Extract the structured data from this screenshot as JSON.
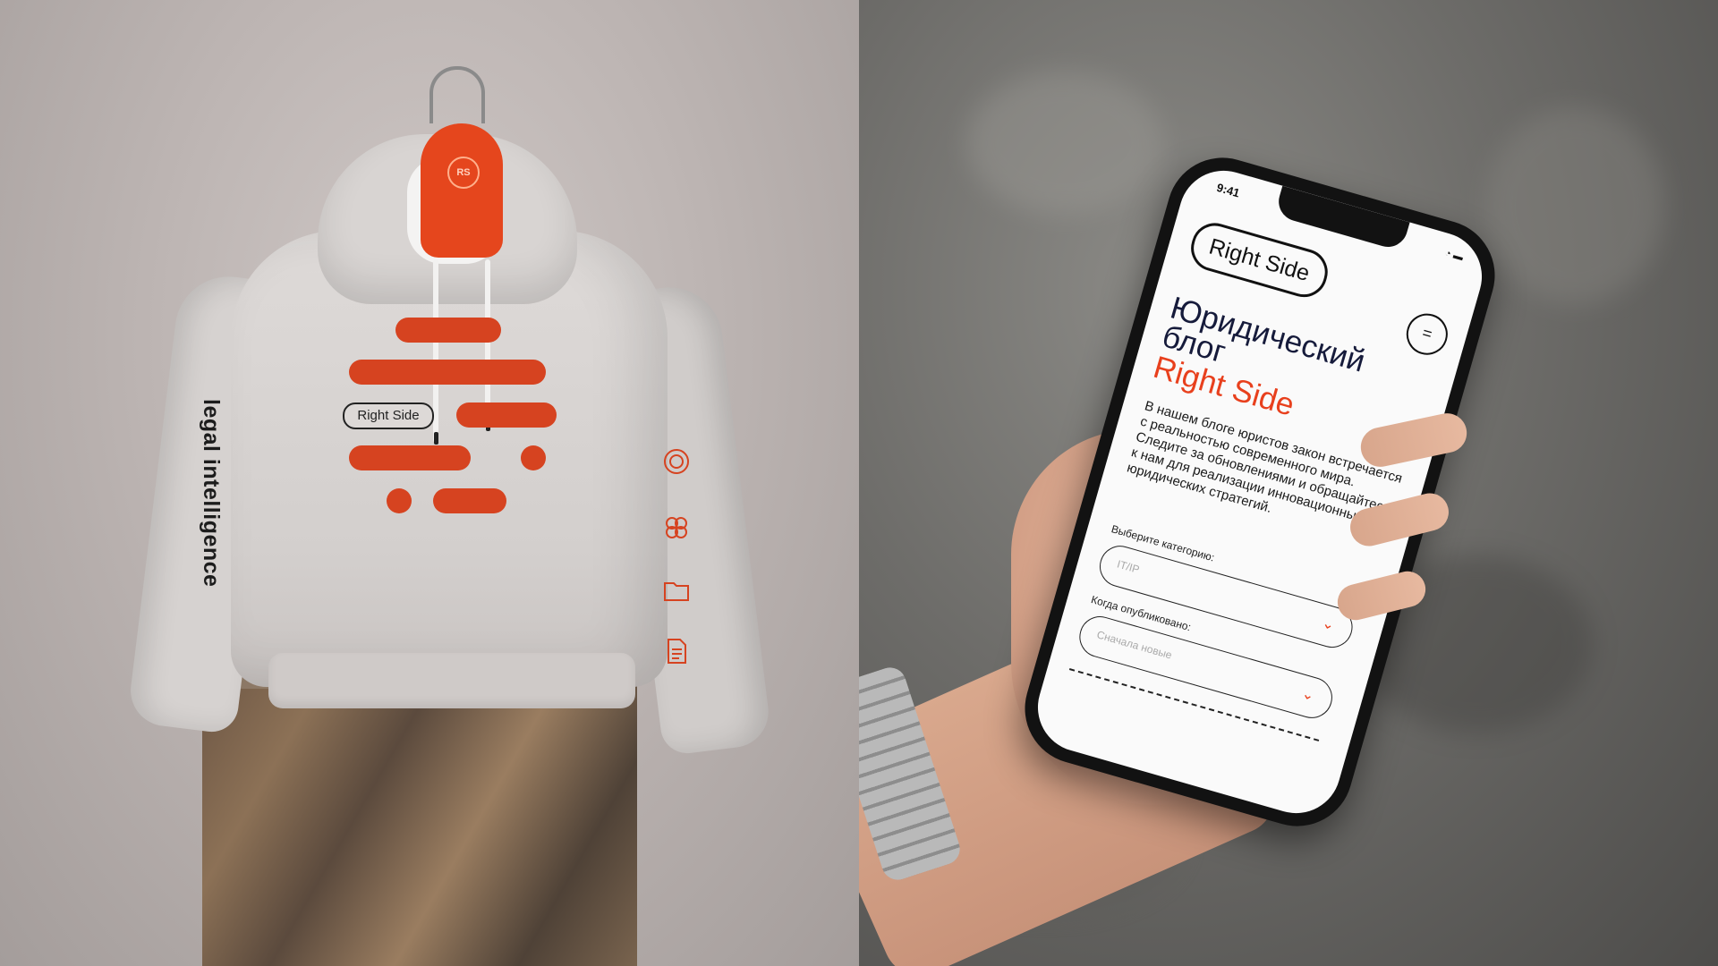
{
  "left": {
    "hanger_logo": "RS",
    "print_label": "Right Side",
    "sleeve_text": "legal intelligence",
    "sleeve_icons": [
      "spiral-icon",
      "flower-icon",
      "folder-icon",
      "document-icon"
    ]
  },
  "phone": {
    "status_time": "9:41",
    "brand": "Right Side",
    "menu_icon": "menu-icon",
    "headline": "Юридический\nблог",
    "headline_brand": "Right Side",
    "intro": "В нашем блоге юристов закон встречается с реальностью современного мира. Следите за обновлениями и обращайтесь к нам для реализации инновационных юридических стратегий.",
    "category_label": "Выберите категорию:",
    "category_placeholder": "IT/IP",
    "date_label": "Когда опубликовано:",
    "date_placeholder": "Сначала новые"
  },
  "colors": {
    "accent": "#e8401d",
    "ink": "#161b3b"
  }
}
